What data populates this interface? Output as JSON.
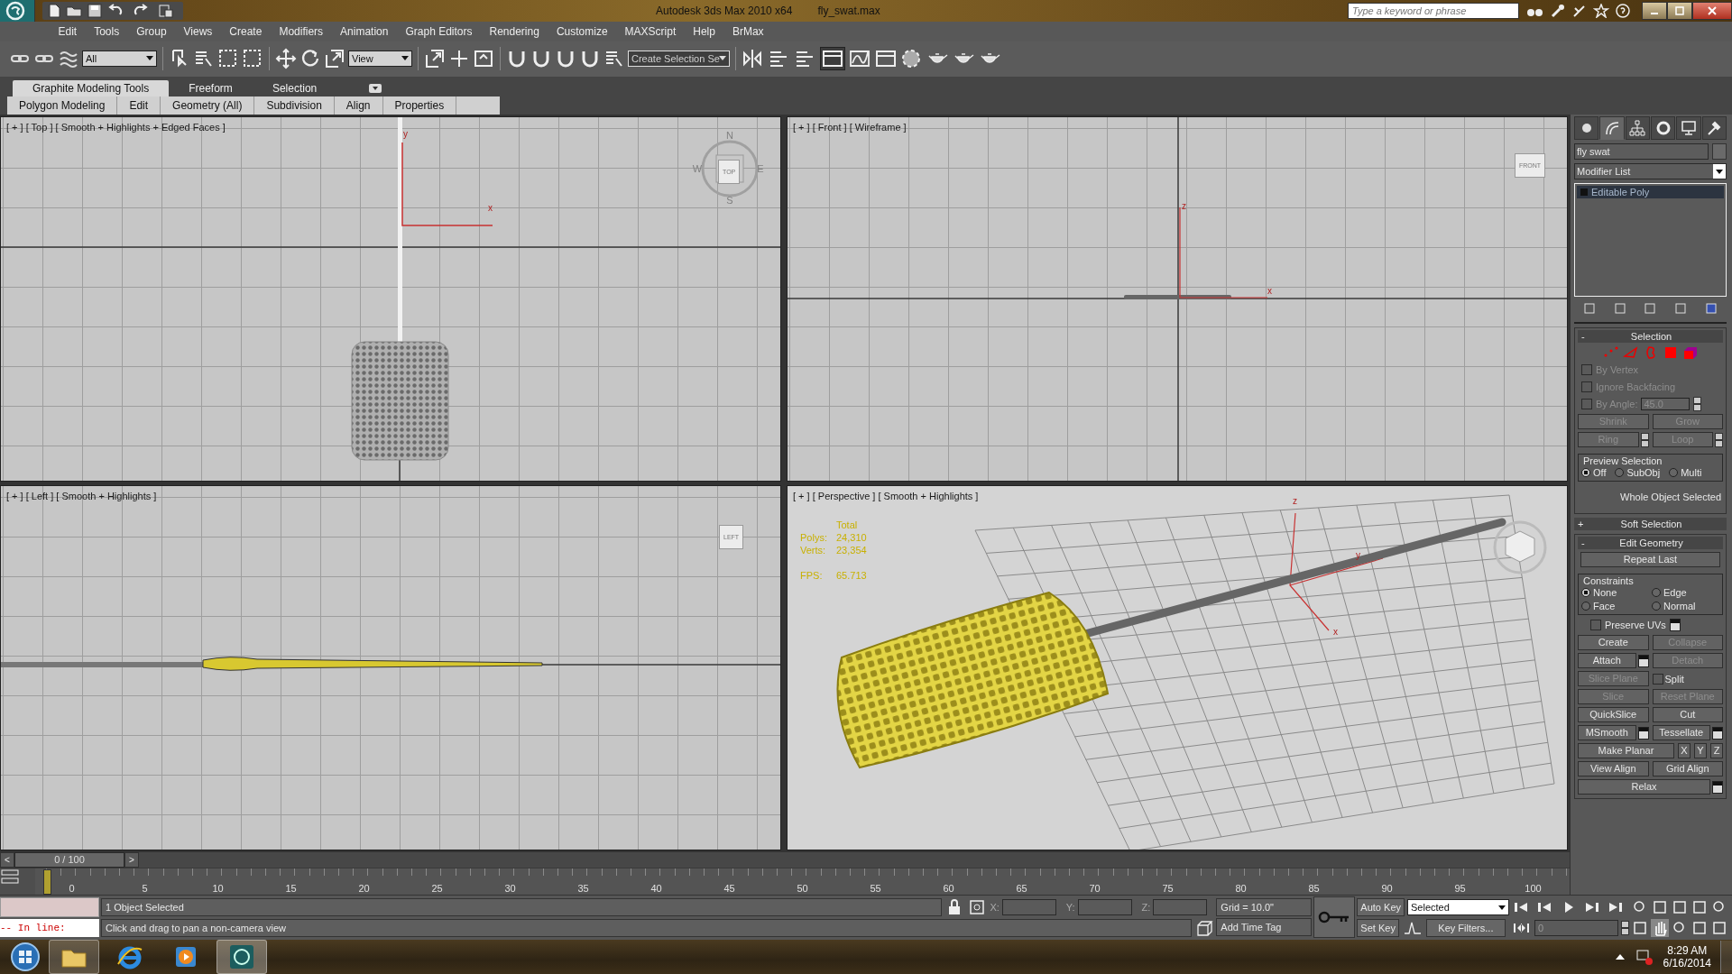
{
  "title_bar": {
    "app_title": "Autodesk 3ds Max  2010 x64",
    "file_name": "fly_swat.max",
    "search": {
      "placeholder": "Type a keyword or phrase"
    }
  },
  "menu": [
    "Edit",
    "Tools",
    "Group",
    "Views",
    "Create",
    "Modifiers",
    "Animation",
    "Graph Editors",
    "Rendering",
    "Customize",
    "MAXScript",
    "Help",
    "BrMax"
  ],
  "toolbar": {
    "selection_filter": "All",
    "reference_coordinates": "View",
    "named_selection": "Create Selection Se"
  },
  "ribbon": {
    "tabs": [
      {
        "label": "Graphite Modeling Tools",
        "selected": true
      },
      {
        "label": "Freeform",
        "selected": false
      },
      {
        "label": "Selection",
        "selected": false
      }
    ],
    "panels": [
      "Polygon Modeling",
      "Edit",
      "Geometry (All)",
      "Subdivision",
      "Align",
      "Properties"
    ]
  },
  "viewports": [
    {
      "kind": "top",
      "label": "[ + ] [ Top ] [ Smooth + Highlights + Edged Faces ]",
      "viewcube": "TOP",
      "compass": [
        "N",
        "E",
        "S",
        "W"
      ],
      "axes": [
        "y",
        "x"
      ]
    },
    {
      "kind": "front",
      "label": "[ + ] [ Front ] [ Wireframe ]",
      "viewcube": "FRONT",
      "axes": [
        "z",
        "x"
      ]
    },
    {
      "kind": "left",
      "label": "[ + ] [ Left ] [ Smooth + Highlights ]",
      "viewcube": "LEFT"
    },
    {
      "kind": "perspective",
      "label": "[ + ] [ Perspective ] [ Smooth + Highlights ]",
      "axes": [
        "z",
        "y",
        "x"
      ],
      "stats": {
        "title": "Total",
        "rows": [
          {
            "label": "Polys:",
            "value": "24,310"
          },
          {
            "label": "Verts:",
            "value": "23,354"
          }
        ],
        "fps_label": "FPS:",
        "fps": "65.713"
      }
    }
  ],
  "command_panel": {
    "tabs": [
      {
        "selected": false
      },
      {
        "selected": true
      },
      {
        "selected": false
      },
      {
        "selected": false
      },
      {
        "selected": false
      },
      {
        "selected": false
      }
    ],
    "object_name": "fly swat",
    "modifier_list": "Modifier List",
    "stack": [
      {
        "label": "Editable Poly",
        "selected": true
      }
    ],
    "selection": {
      "sign": "-",
      "title": "Selection",
      "checks": [
        {
          "label": "By Vertex",
          "checked": false,
          "disabled": true
        },
        {
          "label": "Ignore Backfacing",
          "checked": false,
          "disabled": true
        },
        {
          "label": "By Angle:",
          "checked": false,
          "disabled": true,
          "value": "45.0"
        }
      ],
      "buttons": [
        {
          "label": "Shrink",
          "spinner": false,
          "disabled": true
        },
        {
          "label": "Grow",
          "spinner": false,
          "disabled": true
        },
        {
          "label": "Ring",
          "spinner": true,
          "disabled": true
        },
        {
          "label": "Loop",
          "spinner": true,
          "disabled": true
        }
      ],
      "preview": {
        "title": "Preview Selection",
        "options": [
          {
            "label": "Off",
            "selected": true
          },
          {
            "label": "SubObj",
            "selected": false
          },
          {
            "label": "Multi",
            "selected": false
          }
        ]
      },
      "status": "Whole Object Selected"
    },
    "soft_selection": {
      "sign": "+",
      "title": "Soft Selection"
    },
    "edit_geometry": {
      "sign": "-",
      "title": "Edit Geometry",
      "repeat_last": "Repeat Last",
      "constraints": {
        "title": "Constraints",
        "options": [
          {
            "label": "None",
            "selected": true
          },
          {
            "label": "Edge",
            "selected": false
          },
          {
            "label": "Face",
            "selected": false
          },
          {
            "label": "Normal",
            "selected": false
          }
        ]
      },
      "preserve_uvs": {
        "label": "Preserve UVs",
        "checked": false
      },
      "rows": [
        [
          {
            "kind": "button",
            "label": "Create",
            "disabled": false
          },
          {
            "kind": "button",
            "label": "Collapse",
            "disabled": true
          }
        ],
        [
          {
            "kind": "settings",
            "label": "Attach",
            "disabled": false
          },
          {
            "kind": "button",
            "label": "Detach",
            "disabled": true
          }
        ],
        [
          {
            "kind": "button",
            "label": "Slice Plane",
            "disabled": true
          },
          {
            "kind": "checkbox",
            "label": "Split",
            "checked": false
          }
        ],
        [
          {
            "kind": "button",
            "label": "Slice",
            "disabled": true
          },
          {
            "kind": "button",
            "label": "Reset Plane",
            "disabled": true
          }
        ],
        [
          {
            "kind": "button",
            "label": "QuickSlice",
            "disabled": false
          },
          {
            "kind": "button",
            "label": "Cut",
            "disabled": false
          }
        ],
        [
          {
            "kind": "settings",
            "label": "MSmooth",
            "disabled": false
          },
          {
            "kind": "settings",
            "label": "Tessellate",
            "disabled": false
          }
        ],
        [
          {
            "kind": "button",
            "label": "Make Planar",
            "disabled": false
          },
          {
            "kind": "axis",
            "label": "X",
            "disabled": false
          },
          {
            "kind": "axis",
            "label": "Y",
            "disabled": false
          },
          {
            "kind": "axis",
            "label": "Z",
            "disabled": false
          }
        ],
        [
          {
            "kind": "button",
            "label": "View Align",
            "disabled": false
          },
          {
            "kind": "button",
            "label": "Grid Align",
            "disabled": false
          }
        ],
        [
          {
            "kind": "settings",
            "label": "Relax",
            "disabled": false
          }
        ]
      ]
    }
  },
  "timeline": {
    "prev": "<",
    "next": ">",
    "level": 0,
    "frame": "0 / 100",
    "ticks": [
      "0",
      "5",
      "10",
      "15",
      "20",
      "25",
      "30",
      "35",
      "40",
      "45",
      "50",
      "55",
      "60",
      "65",
      "70",
      "75",
      "80",
      "85",
      "90",
      "95",
      "100"
    ]
  },
  "status": {
    "listener": "-- In line:",
    "selection": "1 Object Selected",
    "prompt": "Click and drag to pan a non-camera view",
    "x_label": "X:",
    "y_label": "Y:",
    "z_label": "Z:",
    "grid": "Grid = 10.0\"",
    "time_tag": "Add Time Tag",
    "auto_key": "Auto Key",
    "set_key": "Set Key",
    "key_mode": "Selected",
    "key_filters": "Key Filters...",
    "current_frame": "0"
  },
  "taskbar": {
    "time": "8:29 AM",
    "date": "6/16/2014"
  }
}
